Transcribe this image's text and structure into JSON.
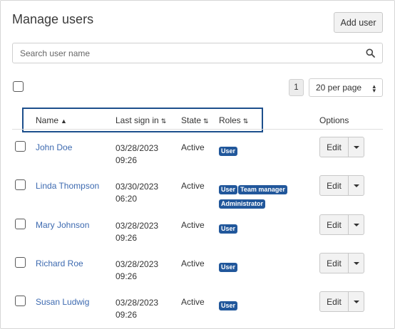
{
  "header": {
    "title": "Manage users",
    "add_user_label": "Add user"
  },
  "search": {
    "placeholder": "Search user name",
    "value": ""
  },
  "pagination": {
    "current_page": "1",
    "per_page": "20 per page"
  },
  "columns": {
    "name": "Name",
    "last_sign_in": "Last sign in",
    "state": "State",
    "roles": "Roles",
    "options": "Options"
  },
  "sort": {
    "name": "▲",
    "last_sign_in": "⇅",
    "state": "⇅",
    "roles": "⇅"
  },
  "edit_label": "Edit",
  "users": [
    {
      "name": "John Doe",
      "date": "03/28/2023",
      "time": "09:26",
      "state": "Active",
      "roles": [
        "User"
      ]
    },
    {
      "name": "Linda Thompson",
      "date": "03/30/2023",
      "time": "06:20",
      "state": "Active",
      "roles": [
        "User",
        "Team manager",
        "Administrator"
      ]
    },
    {
      "name": "Mary Johnson",
      "date": "03/28/2023",
      "time": "09:26",
      "state": "Active",
      "roles": [
        "User"
      ]
    },
    {
      "name": "Richard Roe",
      "date": "03/28/2023",
      "time": "09:26",
      "state": "Active",
      "roles": [
        "User"
      ]
    },
    {
      "name": "Susan Ludwig",
      "date": "03/28/2023",
      "time": "09:26",
      "state": "Active",
      "roles": [
        "User"
      ]
    }
  ],
  "colors": {
    "link": "#3d6ab0",
    "badge": "#21579b",
    "highlight_border": "#1d4f8c"
  },
  "icons": {
    "search": "search-icon",
    "sort": "sort-icon",
    "caret": "chevron-down-icon"
  }
}
